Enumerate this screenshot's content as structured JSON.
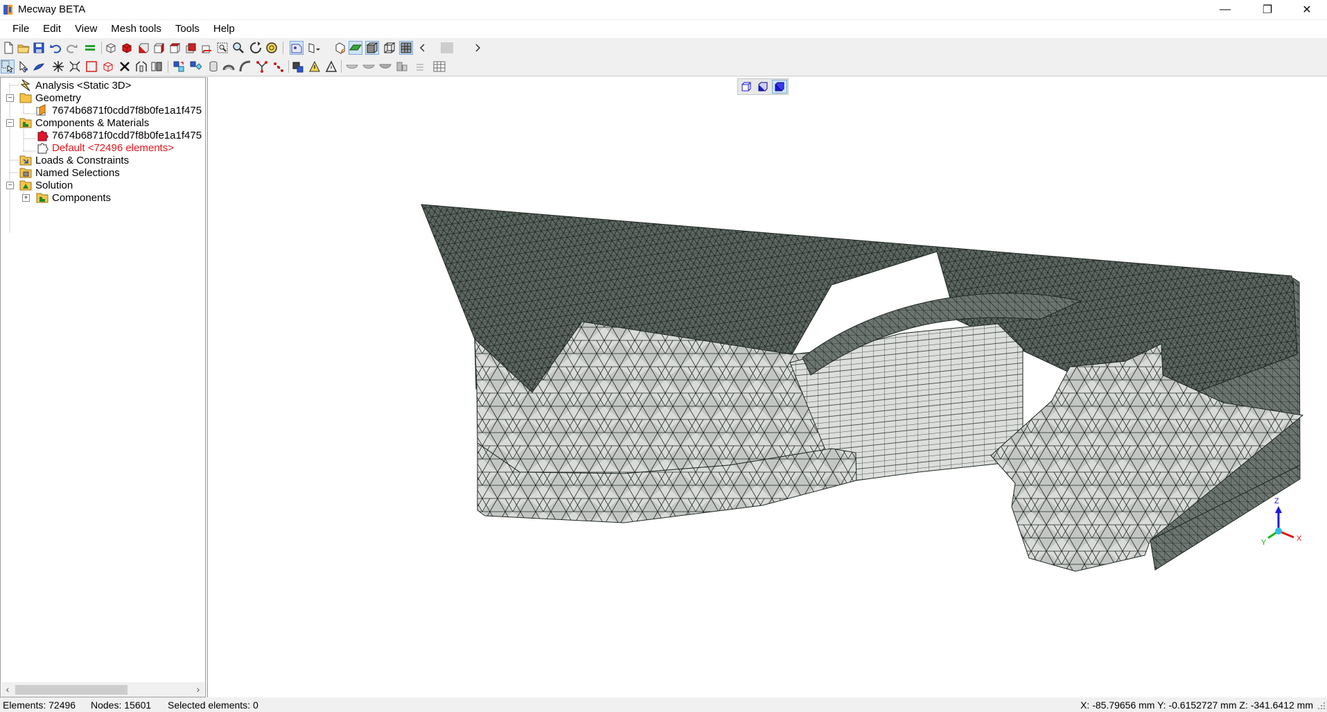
{
  "window": {
    "title": "Mecway BETA",
    "minimize_glyph": "—",
    "restore_glyph": "❐",
    "close_glyph": "✕"
  },
  "menu": [
    "File",
    "Edit",
    "View",
    "Mesh tools",
    "Tools",
    "Help"
  ],
  "tree": {
    "analysis": "Analysis <Static 3D>",
    "geometry": "Geometry",
    "geometry_child": "7674b6871f0cdd7f8b0fe1a1f475",
    "components_materials": "Components & Materials",
    "component_child": "7674b6871f0cdd7f8b0fe1a1f475",
    "default_material": "Default <72496 elements>",
    "loads_constraints": "Loads & Constraints",
    "named_selections": "Named Selections",
    "solution": "Solution",
    "solution_components": "Components",
    "expanded_glyph": "−",
    "collapsed_glyph": "+"
  },
  "status": {
    "elements": "Elements: 72496",
    "nodes": "Nodes: 15601",
    "selected": "Selected elements: 0",
    "coords": "X: -85.79656 mm Y: -0.6152727 mm Z: -341.6412 mm"
  },
  "triad": {
    "x": "X",
    "y": "Y",
    "z": "Z"
  },
  "colors": {
    "mesh_top": "#5f6762",
    "mesh_side": "#d9dbd9",
    "mesh_line": "#1d2620",
    "default_material_text": "#e8141c",
    "axis_x": "#e01010",
    "axis_y": "#12b812",
    "axis_z": "#1a1ae0"
  },
  "icons": {
    "toolbar1": [
      "new-file",
      "open-folder",
      "save-disk",
      "undo",
      "redo",
      "green-bars",
      "cube-wireframe",
      "cube-red",
      "cube-red-front",
      "cube-red-side",
      "cube-red-top",
      "cube-red-back",
      "cube-red-iso",
      "zoom-box",
      "zoom",
      "rotate",
      "zoom-fit",
      "select-mode",
      "mesh-dropdown",
      "view-mode",
      "shade-green",
      "shade-solid",
      "wireframe",
      "mesh-grid",
      "scroll-left",
      "scroll-thumb",
      "scroll-right"
    ],
    "toolbar2": [
      "select-arrow",
      "pick-node",
      "paint-brush",
      "explode",
      "explode-2",
      "rectangle-select",
      "cube-outline",
      "delete",
      "merge",
      "extrude",
      "move",
      "copy",
      "cylinder",
      "revolve",
      "sweep",
      "connect",
      "split",
      "measure",
      "plot-triangle",
      "triangle-outline",
      "dish-1",
      "dish-2",
      "dish-3",
      "align",
      "table"
    ]
  }
}
